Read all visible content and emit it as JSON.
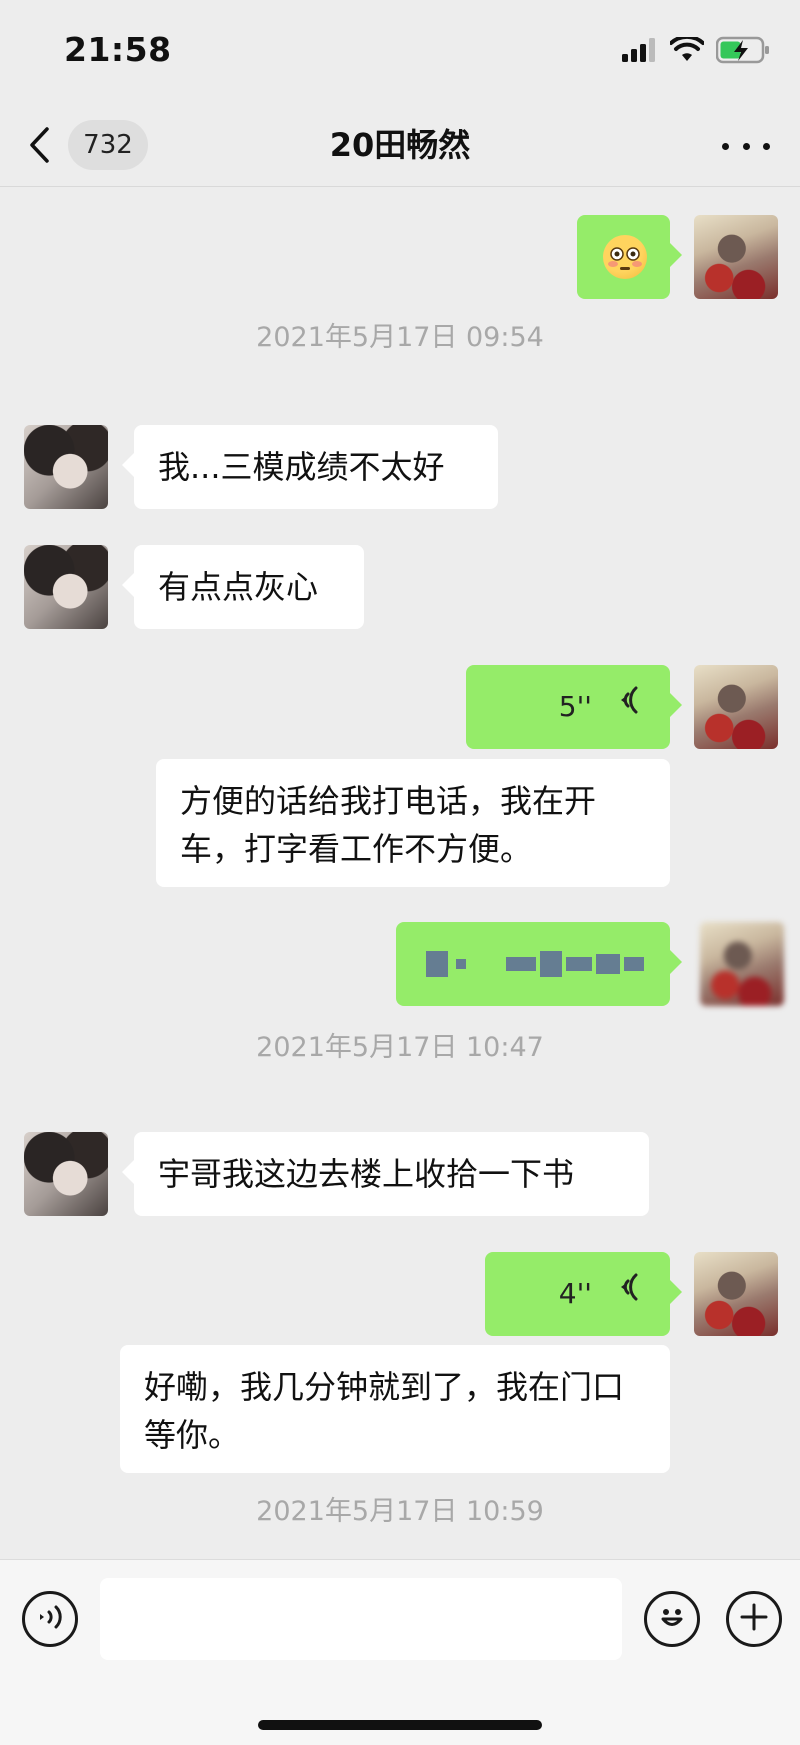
{
  "status_bar": {
    "time": "21:58",
    "icons": [
      "signal-icon",
      "wifi-icon",
      "battery-charging-icon"
    ]
  },
  "nav": {
    "unread_count": "732",
    "title": "20田畅然"
  },
  "messages": {
    "m1": {
      "type": "emoji",
      "emoji": "flushed-face"
    },
    "ts1": "2021年5月17日 09:54",
    "m2": {
      "text": "我...三模成绩不太好"
    },
    "m3": {
      "text": "有点点灰心"
    },
    "m4": {
      "duration": "5''"
    },
    "m4_transcript": {
      "text": "方便的话给我打电话，我在开车，打字看工作不方便。"
    },
    "m5": {
      "type": "censored"
    },
    "ts2": "2021年5月17日 10:47",
    "m6": {
      "text": "宇哥我这边去楼上收拾一下书"
    },
    "m7": {
      "duration": "4''"
    },
    "m7_transcript": {
      "text": "好嘞，我几分钟就到了，我在门口等你。"
    },
    "ts3": "2021年5月17日 10:59"
  },
  "input": {
    "placeholder": "",
    "value": ""
  },
  "colors": {
    "bubble_green": "#95ec69",
    "bubble_white": "#ffffff",
    "background": "#ededed",
    "timestamp": "#a8a8a8"
  }
}
